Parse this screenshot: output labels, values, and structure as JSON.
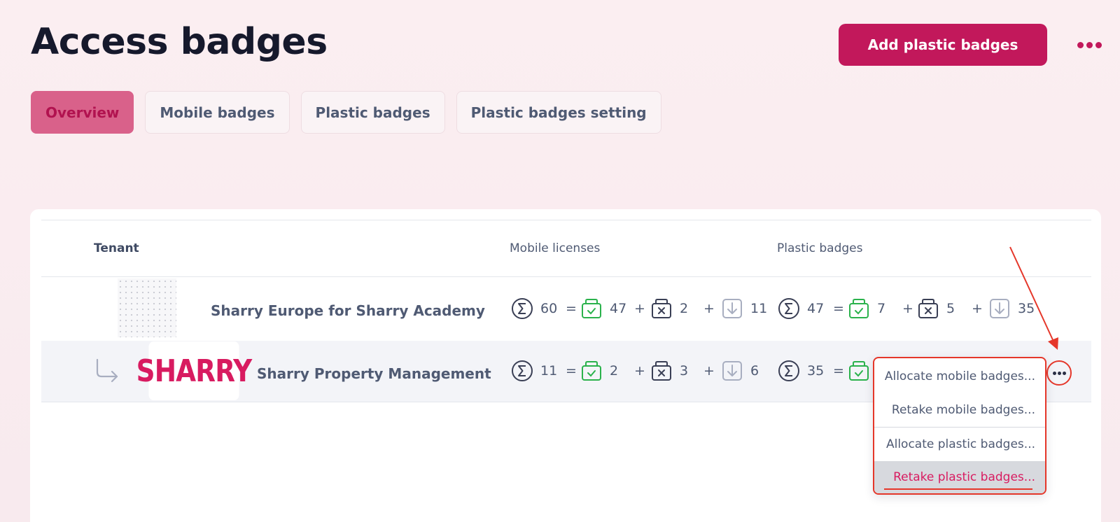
{
  "page": {
    "title": "Access badges",
    "add_button_label": "Add plastic badges"
  },
  "tabs": [
    {
      "label": "Overview",
      "active": true
    },
    {
      "label": "Mobile badges",
      "active": false
    },
    {
      "label": "Plastic badges",
      "active": false
    },
    {
      "label": "Plastic badges setting",
      "active": false
    }
  ],
  "table": {
    "headers": {
      "tenant": "Tenant",
      "mobile": "Mobile licenses",
      "plastic": "Plastic badges"
    },
    "rows": [
      {
        "name": "Sharry Europe for Sharry Academy",
        "mobile": {
          "total": "60",
          "active": "47",
          "blocked": "2",
          "available": "11"
        },
        "plastic": {
          "total": "47",
          "active": "7",
          "blocked": "5",
          "available": "35"
        }
      },
      {
        "name": "Sharry Property Management",
        "logo_text": "SHARRY",
        "mobile": {
          "total": "11",
          "active": "2",
          "blocked": "3",
          "available": "6"
        },
        "plastic": {
          "total": "35"
        }
      }
    ],
    "operators": {
      "eq": "=",
      "plus": "+"
    }
  },
  "context_menu": {
    "items": [
      "Allocate mobile badges...",
      "Retake mobile badges...",
      "Allocate plastic badges...",
      "Retake plastic badges..."
    ],
    "highlighted_index": 3
  },
  "colors": {
    "brand": "#c2185b",
    "active_tab_bg": "#d9618a",
    "annotation_red": "#e5372a",
    "green_icon": "#2bb24c",
    "dark_icon": "#3a3f55",
    "muted_icon": "#a8aec0"
  },
  "icons": [
    "sum-icon",
    "badge-active-icon",
    "badge-blocked-icon",
    "badge-available-icon",
    "more-icon",
    "subtenant-arrow-icon"
  ]
}
